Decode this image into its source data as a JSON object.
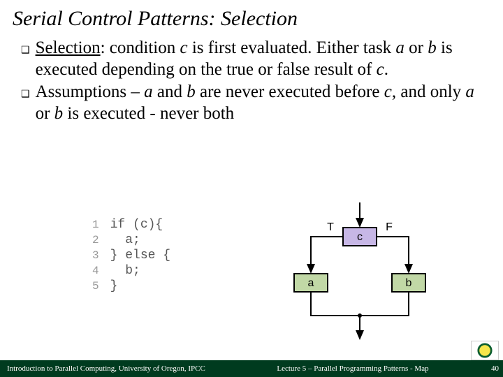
{
  "title": "Serial Control Patterns: Selection",
  "bullets": [
    {
      "lead_under": "Selection",
      "text_1": ": condition ",
      "c1": "c",
      "text_2": " is first evaluated. Either task ",
      "a1": "a",
      "text_3": " or ",
      "b1": "b",
      "text_4": " is executed depending on the true or false result of ",
      "c2": "c",
      "text_5": "."
    },
    {
      "text_1": "Assumptions – ",
      "a1": "a",
      "text_2": " and ",
      "b1": "b",
      "text_3": " are never executed before ",
      "c1": "c",
      "text_4": ", and only ",
      "a2": "a",
      "text_5": " or ",
      "b2": "b",
      "text_6": " is executed - never both"
    }
  ],
  "code": {
    "lines": [
      {
        "n": "1",
        "t": "if (c){"
      },
      {
        "n": "2",
        "t": "  a;"
      },
      {
        "n": "3",
        "t": "} else {"
      },
      {
        "n": "4",
        "t": "  b;"
      },
      {
        "n": "5",
        "t": "}"
      }
    ]
  },
  "flow": {
    "T": "T",
    "F": "F",
    "c": "c",
    "a": "a",
    "b": "b"
  },
  "footer": {
    "left": "Introduction to Parallel Computing, University of Oregon, IPCC",
    "center": "Lecture 5 – Parallel Programming Patterns - Map",
    "right": "40"
  }
}
